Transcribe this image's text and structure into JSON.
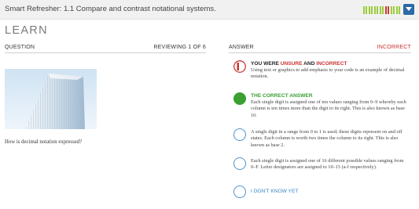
{
  "topbar": {
    "title": "Smart Refresher: 1.1 Compare and contrast notational systems.",
    "progress": [
      "good",
      "good",
      "good",
      "good",
      "good",
      "good",
      "good",
      "good",
      "bad",
      "bad",
      "good",
      "good",
      "good",
      "good"
    ]
  },
  "learn_heading": "LEARN",
  "question": {
    "header_label": "QUESTION",
    "reviewing": "REVIEWING 1 OF 6",
    "text": "How is decimal notation expressed?"
  },
  "answer": {
    "header_label": "ANSWER",
    "status": "INCORRECT",
    "feedback": {
      "label_prefix": "YOU WERE ",
      "label_unsure": "UNSURE",
      "label_and": " AND ",
      "label_incorrect": "INCORRECT",
      "text": "Using text or graphics to add emphasis to your code is an example of decimal notation."
    },
    "correct": {
      "label": "THE CORRECT ANSWER",
      "text": "Each single digit is assigned one of ten values ranging from 0–9 whereby each column is ten times more than the digit to its right. This is also known as base 10."
    },
    "options": [
      "A single digit in a range from 0 to 1 is used; these digits represent on and off states. Each column is worth two times the column to its right. This is also known as base 2.",
      "Each single digit is assigned one of 16 different possible values ranging from 0–F. Letter designators are assigned to 10–15 (a-f respectively)."
    ],
    "dont_know": "I DON'T KNOW YET"
  },
  "colors": {
    "accent_blue": "#2b6aa6",
    "correct_green": "#3aa032",
    "incorrect_red": "#c8322f"
  }
}
